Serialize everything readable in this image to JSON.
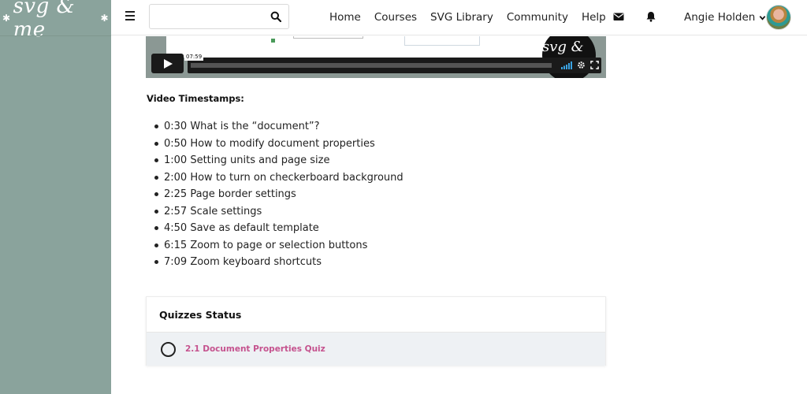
{
  "brand": {
    "logo_text": "svg & me",
    "accent_color": "#c5528e",
    "sidebar_color": "#8aa39c"
  },
  "header": {
    "search": {
      "value": "",
      "placeholder": "",
      "icon": "search-icon"
    },
    "nav": [
      "Home",
      "Courses",
      "SVG Library",
      "Community",
      "Help"
    ],
    "icons": [
      "menu-icon",
      "envelope-icon",
      "bell-icon"
    ],
    "user": {
      "name": "Angie Holden",
      "icon": "chevron-down-icon"
    }
  },
  "video": {
    "time_tooltip": "07:59",
    "brand_text": "svg & me"
  },
  "timestamps": {
    "title": "Video Timestamps:",
    "items": [
      "0:30 What is the “document”?",
      "0:50 How to modify document properties",
      "1:00 Setting units and page size",
      "2:00 How to turn on checkerboard background",
      "2:25 Page border settings",
      "2:57 Scale settings",
      "4:50 Save as default template",
      "6:15 Zoom to page or selection buttons",
      "7:09 Zoom keyboard shortcuts"
    ]
  },
  "quizzes": {
    "title": "Quizzes Status",
    "items": [
      {
        "label": "2.1 Document Properties Quiz",
        "status": "not-started"
      }
    ]
  }
}
